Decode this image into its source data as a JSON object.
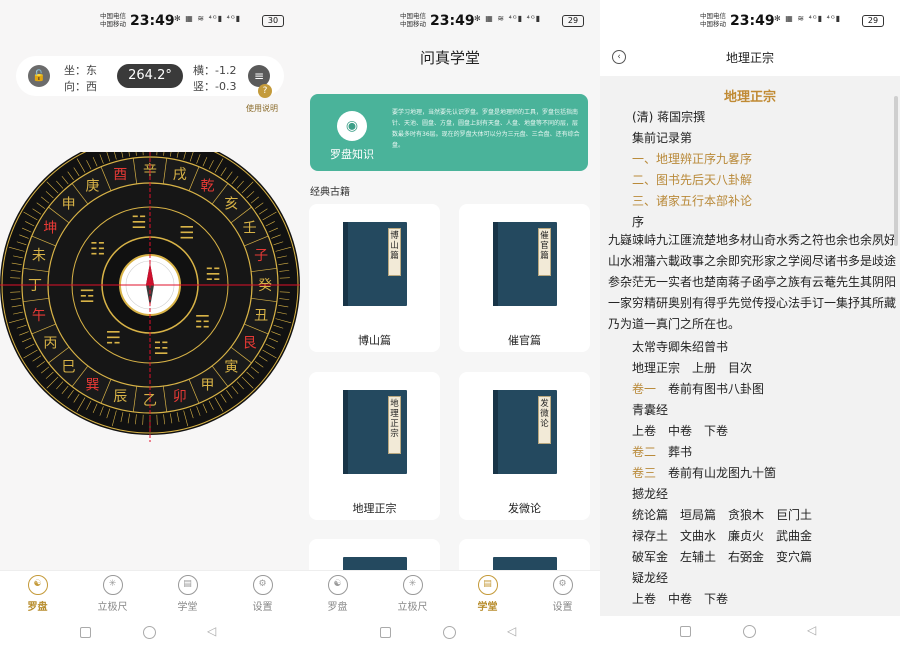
{
  "status": {
    "carrier_line1": "中国电信",
    "carrier_line2": "中国移动",
    "time": "23:49",
    "icons": "✻ ▦ ≋ ⁴ᴳ▮ ⁴ᴳ▮",
    "battery_screen1": "30",
    "battery_screen2": "29",
    "battery_screen3": "29"
  },
  "compass_screen": {
    "lock_icon_glyph": "🔓",
    "sit_label": "坐：东",
    "face_label": "向：西",
    "heading": "264.2°",
    "horizontal_label": "横：-1.2",
    "vertical_label": "竖：-0.3",
    "menu_icon_glyph": "≡",
    "help_glyph": "?",
    "help_text": "使用说明",
    "ring_chars": [
      "酉",
      "辛",
      "戌",
      "乾",
      "亥",
      "壬",
      "子",
      "癸",
      "丑",
      "艮",
      "寅",
      "甲",
      "卯",
      "乙",
      "辰",
      "巽",
      "巳",
      "丙",
      "午",
      "丁",
      "未",
      "坤",
      "申",
      "庚"
    ],
    "trigrams": [
      "☱",
      "☰",
      "☵",
      "☶",
      "☳",
      "☴",
      "☲",
      "☷"
    ],
    "accent": "#d8b347",
    "ring_dark": "#1a1a1a"
  },
  "bottom_nav": {
    "items": [
      {
        "label": "罗盘",
        "icon": "compass-icon",
        "glyph": "☯"
      },
      {
        "label": "立极尺",
        "icon": "ruler-dial-icon",
        "glyph": "✳"
      },
      {
        "label": "学堂",
        "icon": "book-icon",
        "glyph": "▤"
      },
      {
        "label": "设置",
        "icon": "settings-icon",
        "glyph": "⚙"
      }
    ],
    "back_glyph": "◁"
  },
  "school_screen": {
    "title": "问真学堂",
    "banner": {
      "icon_glyph": "◉",
      "label": "罗盘知识",
      "description": "要学习地理，当然要先认识罗盘。罗盘是地理师的工具，罗盘包括指南针、天池、圆盘、方盘，圆盘上刻有天盘、人盘、地盘等不同的层，层数最多时有36层。现在的罗盘大体可以分为三元盘、三合盘、还有综合盘。"
    },
    "section_title": "经典古籍",
    "books": [
      {
        "name": "博山篇",
        "cover": "博山篇"
      },
      {
        "name": "催官篇",
        "cover": "催官篇"
      },
      {
        "name": "地理正宗",
        "cover": "地理正宗"
      },
      {
        "name": "发微论",
        "cover": "发微论"
      }
    ]
  },
  "reader_screen": {
    "header_title": "地理正宗",
    "back_glyph": "‹",
    "doc_title": "地理正宗",
    "lines_top": [
      {
        "text": "(清) 蒋国宗撰",
        "gold": false
      },
      {
        "text": "集前记录第",
        "gold": false
      },
      {
        "text": "一、地理辨正序九畧序",
        "gold": true
      },
      {
        "text": "二、图书先后天八卦解",
        "gold": true
      },
      {
        "text": "三、诸家五行本部补论",
        "gold": true
      },
      {
        "text": "序",
        "gold": false
      }
    ],
    "paragraph": "九嶷竦峙九江匯流楚地多材山奇水秀之符也余也余夙好山水湘藩六載政事之余即究形家之学阅尽诸书多是歧途参杂茫无一实者也楚南蒋子函亭之族有云菴先生其阴阳一家穷精研奥别有得乎先觉传授心法手订一集抒其所藏乃为道一真门之所在也。",
    "lines_bottom": [
      {
        "text": "太常寺卿朱绍曾书",
        "gold": false
      },
      {
        "text": "地理正宗　上册　目次",
        "gold": false
      },
      {
        "text": "卷一",
        "rest": "卷前有图书八卦图"
      },
      {
        "text": "青囊经",
        "gold": false
      },
      {
        "text": "上卷　中卷　下卷",
        "gold": false
      },
      {
        "text": "卷二",
        "rest": "葬书"
      },
      {
        "text": "卷三",
        "rest": "卷前有山龙图九十箇"
      },
      {
        "text": "撼龙经",
        "gold": false
      },
      {
        "text": "统论篇　垣局篇　贪狼木　巨门土",
        "gold": false
      },
      {
        "text": "禄存土　文曲水　廉贞火　武曲金",
        "gold": false
      },
      {
        "text": "破军金　左辅土　右弼金　变穴篇",
        "gold": false
      },
      {
        "text": "疑龙经",
        "gold": false
      },
      {
        "text": "上卷　中卷　下卷",
        "gold": false
      }
    ]
  }
}
